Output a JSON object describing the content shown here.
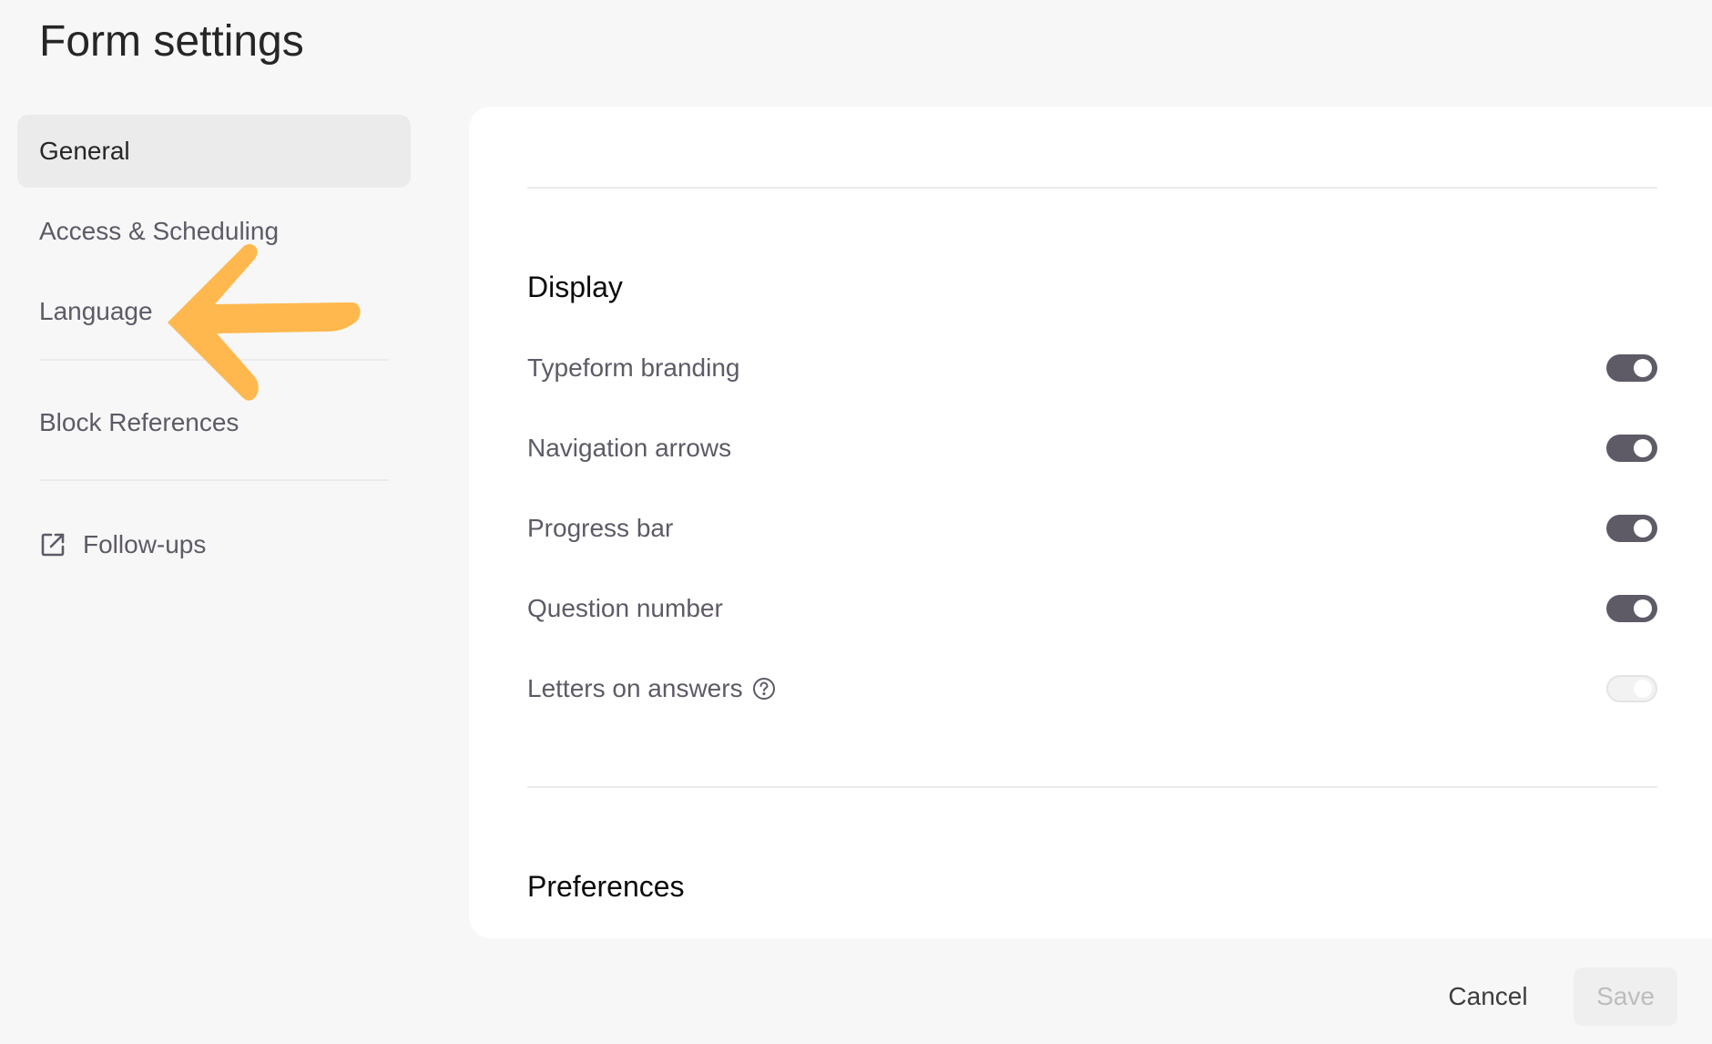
{
  "page": {
    "title": "Form settings"
  },
  "sidebar": {
    "items": [
      {
        "label": "General",
        "active": true
      },
      {
        "label": "Access & Scheduling",
        "active": false
      },
      {
        "label": "Language",
        "active": false
      },
      {
        "label": "Block References",
        "active": false
      },
      {
        "label": "Follow-ups",
        "active": false,
        "icon": "external-link-icon"
      }
    ]
  },
  "annotation": {
    "icon": "arrow-left-icon",
    "color": "#ffb84d"
  },
  "display": {
    "title": "Display",
    "settings": [
      {
        "label": "Typeform branding",
        "enabled": true
      },
      {
        "label": "Navigation arrows",
        "enabled": true
      },
      {
        "label": "Progress bar",
        "enabled": true
      },
      {
        "label": "Question number",
        "enabled": true
      },
      {
        "label": "Letters on answers",
        "enabled": false,
        "icon": "help-icon"
      }
    ]
  },
  "preferences": {
    "title": "Preferences"
  },
  "footer": {
    "cancel_label": "Cancel",
    "save_label": "Save"
  },
  "colors": {
    "toggle_on": "#5e5a66",
    "accent_arrow": "#ffb84d",
    "background": "#f7f7f7"
  }
}
